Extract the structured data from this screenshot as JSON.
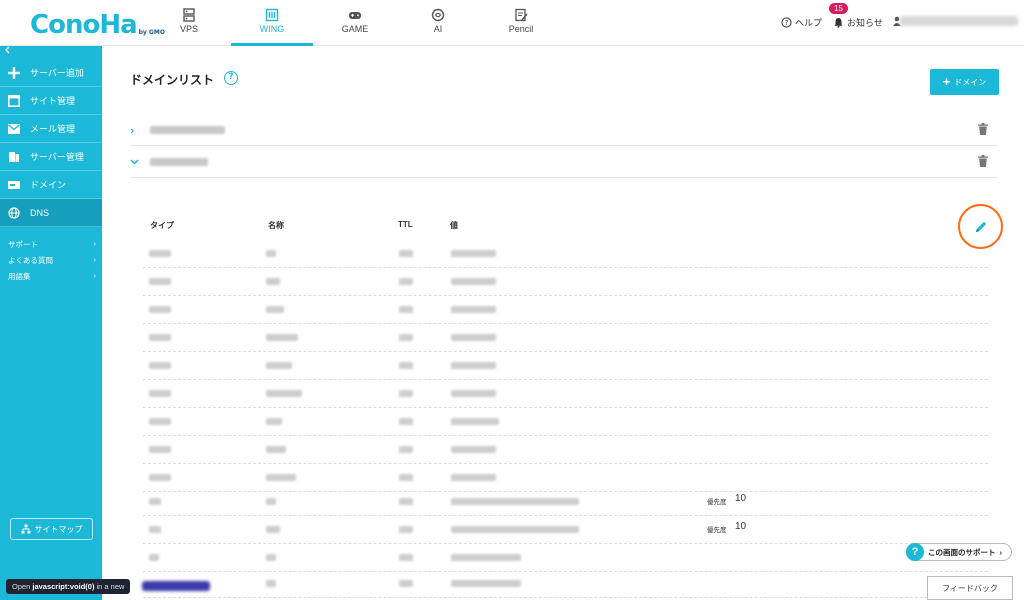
{
  "header": {
    "logo_text": "ConoHa",
    "logo_sub": "by GMO",
    "tabs": [
      {
        "label": "VPS",
        "icon": "server-icon"
      },
      {
        "label": "WING",
        "icon": "wing-icon"
      },
      {
        "label": "GAME",
        "icon": "gamepad-icon"
      },
      {
        "label": "AI",
        "icon": "ai-chip-icon"
      },
      {
        "label": "Pencil",
        "icon": "pencil-note-icon"
      }
    ],
    "help_label": "ヘルプ",
    "notice_label": "お知らせ",
    "notice_count": "15"
  },
  "sidebar": {
    "items": [
      {
        "label": "サーバー追加",
        "icon": "plus-icon"
      },
      {
        "label": "サイト管理",
        "icon": "window-icon"
      },
      {
        "label": "メール管理",
        "icon": "mail-icon"
      },
      {
        "label": "サーバー管理",
        "icon": "server-manage-icon"
      },
      {
        "label": "ドメイン",
        "icon": "domain-icon"
      },
      {
        "label": "DNS",
        "icon": "globe-icon"
      }
    ],
    "links": [
      {
        "label": "サポート"
      },
      {
        "label": "よくある質問"
      },
      {
        "label": "用語集"
      }
    ],
    "sitemap_label": "サイトマップ"
  },
  "main": {
    "title": "ドメインリスト",
    "add_button_label": "ドメイン",
    "dns_table": {
      "headers": {
        "type": "タイプ",
        "name": "名称",
        "ttl": "TTL",
        "value": "値"
      },
      "priority_label": "優先度",
      "priority_values": [
        "10",
        "10"
      ]
    }
  },
  "support_label": "この画面のサポート",
  "feedback_label": "フィードバック",
  "status_bar": {
    "prefix": "Open",
    "link": "javascript:void(0)",
    "suffix": "in a new"
  },
  "colors": {
    "accent": "#1cb8d8",
    "highlight_ring": "#ff6a13",
    "badge": "#d81b60"
  }
}
